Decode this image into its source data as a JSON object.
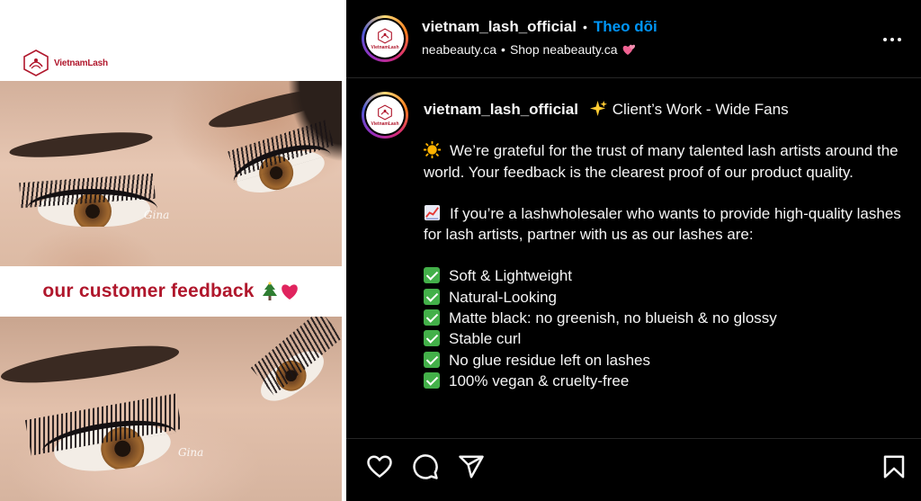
{
  "media": {
    "brand_logo_text": "VietnamLash",
    "banner_text": "our customer feedback",
    "banner_emojis": [
      "tree-icon",
      "heart-icon"
    ],
    "watermark_top": "Gina",
    "watermark_bottom": "Gina"
  },
  "header": {
    "username": "vietnam_lash_official",
    "separator": "•",
    "follow_label": "Theo dõi",
    "website": "neabeauty.ca",
    "website_separator": "•",
    "shop_text": "Shop neabeauty.ca",
    "shop_emoji": "two-hearts-icon",
    "more_icon": "more-horizontal-icon"
  },
  "avatar": {
    "mini_text": "VietnamLash"
  },
  "caption": {
    "username": "vietnam_lash_official",
    "title": "Client’s Work - Wide Fans",
    "title_emoji": "sparkles-icon",
    "paragraph1_emoji": "sun-icon",
    "paragraph1": "We’re grateful for the trust of many talented lash artists around the world. Your feedback is the clearest proof of our product quality.",
    "paragraph2_emoji": "chart-increasing-icon",
    "paragraph2": "If you’re a lashwholesaler who wants to provide high-quality lashes for lash artists, partner with us as our lashes are:",
    "features": [
      "Soft & Lightweight",
      "Natural-Looking",
      "Matte black: no greenish, no blueish & no glossy",
      "Stable curl",
      "No glue residue left on lashes",
      "100% vegan & cruelty-free"
    ]
  },
  "actions": {
    "icons": [
      "heart-outline-icon",
      "comment-icon",
      "share-icon",
      "bookmark-icon"
    ]
  },
  "colors": {
    "brand_red": "#b0172c",
    "follow_blue": "#0095f6",
    "check_green": "#43b049",
    "background": "#000000",
    "text": "#f5f5f5"
  }
}
